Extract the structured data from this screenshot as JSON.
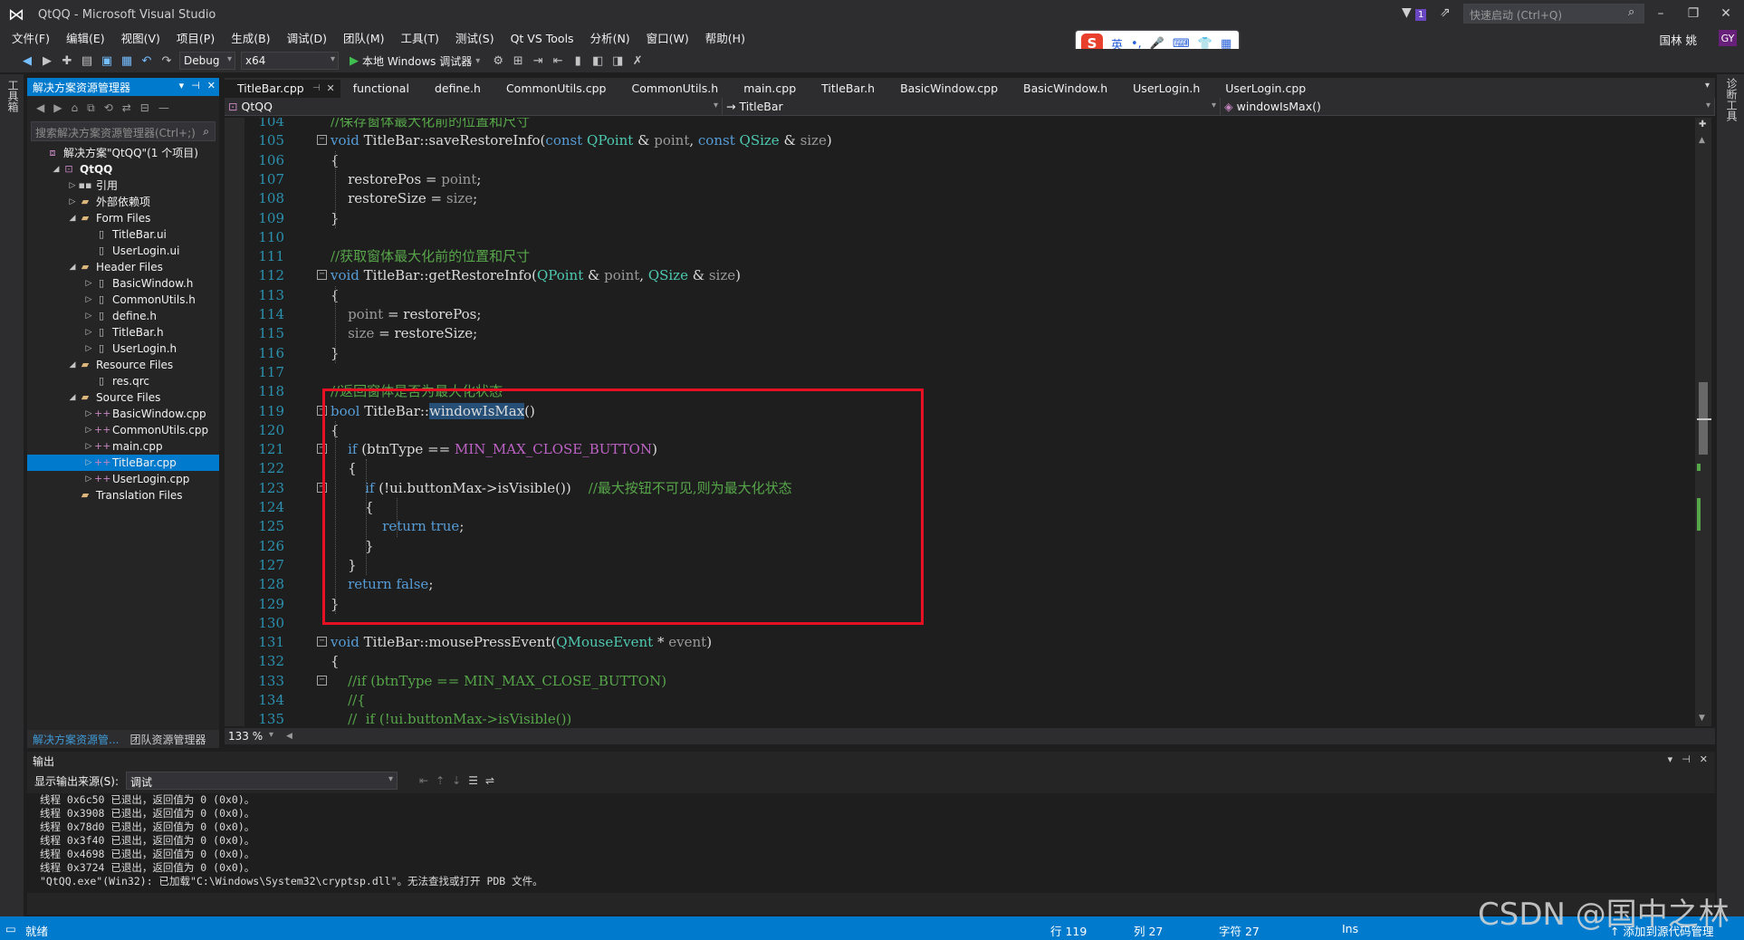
{
  "window": {
    "title": "QtQQ - Microsoft Visual Studio",
    "quick_launch_placeholder": "快速启动 (Ctrl+Q)",
    "notification_count": "1",
    "user": "国林 姚",
    "avatar_initials": "GY"
  },
  "ime": {
    "mode": "英",
    "items": [
      "•,",
      "🎤",
      "⌨",
      "👕",
      "▦"
    ]
  },
  "menu": [
    "文件(F)",
    "编辑(E)",
    "视图(V)",
    "项目(P)",
    "生成(B)",
    "调试(D)",
    "团队(M)",
    "工具(T)",
    "测试(S)",
    "Qt VS Tools",
    "分析(N)",
    "窗口(W)",
    "帮助(H)"
  ],
  "toolbar": {
    "config": "Debug",
    "platform": "x64",
    "run_label": "本地 Windows 调试器"
  },
  "left_strip_label": "工具箱",
  "right_strip_label": "诊断工具",
  "solution_explorer": {
    "title": "解决方案资源管理器",
    "search_placeholder": "搜索解决方案资源管理器(Ctrl+;)",
    "tree": [
      {
        "label": "解决方案\"QtQQ\"(1 个项目)",
        "depth": 0,
        "arrow": "",
        "icon": "sol"
      },
      {
        "label": "QtQQ",
        "depth": 1,
        "arrow": "◢",
        "icon": "proj",
        "bold": true
      },
      {
        "label": "引用",
        "depth": 2,
        "arrow": "▷",
        "icon": "ref"
      },
      {
        "label": "外部依赖项",
        "depth": 2,
        "arrow": "▷",
        "icon": "folder"
      },
      {
        "label": "Form Files",
        "depth": 2,
        "arrow": "◢",
        "icon": "folder"
      },
      {
        "label": "TitleBar.ui",
        "depth": 3,
        "arrow": "",
        "icon": "file"
      },
      {
        "label": "UserLogin.ui",
        "depth": 3,
        "arrow": "",
        "icon": "file"
      },
      {
        "label": "Header Files",
        "depth": 2,
        "arrow": "◢",
        "icon": "folder"
      },
      {
        "label": "BasicWindow.h",
        "depth": 3,
        "arrow": "▷",
        "icon": "file"
      },
      {
        "label": "CommonUtils.h",
        "depth": 3,
        "arrow": "▷",
        "icon": "file"
      },
      {
        "label": "define.h",
        "depth": 3,
        "arrow": "▷",
        "icon": "file"
      },
      {
        "label": "TitleBar.h",
        "depth": 3,
        "arrow": "▷",
        "icon": "file"
      },
      {
        "label": "UserLogin.h",
        "depth": 3,
        "arrow": "▷",
        "icon": "file"
      },
      {
        "label": "Resource Files",
        "depth": 2,
        "arrow": "◢",
        "icon": "folder"
      },
      {
        "label": "res.qrc",
        "depth": 3,
        "arrow": "",
        "icon": "file"
      },
      {
        "label": "Source Files",
        "depth": 2,
        "arrow": "◢",
        "icon": "folder"
      },
      {
        "label": "BasicWindow.cpp",
        "depth": 3,
        "arrow": "▷",
        "icon": "cpp"
      },
      {
        "label": "CommonUtils.cpp",
        "depth": 3,
        "arrow": "▷",
        "icon": "cpp"
      },
      {
        "label": "main.cpp",
        "depth": 3,
        "arrow": "▷",
        "icon": "cpp"
      },
      {
        "label": "TitleBar.cpp",
        "depth": 3,
        "arrow": "▷",
        "icon": "cpp",
        "selected": true
      },
      {
        "label": "UserLogin.cpp",
        "depth": 3,
        "arrow": "▷",
        "icon": "cpp"
      },
      {
        "label": "Translation Files",
        "depth": 2,
        "arrow": "",
        "icon": "folder"
      }
    ],
    "bottom_tabs": [
      "解决方案资源管...",
      "团队资源管理器"
    ]
  },
  "doc_tabs": [
    "TitleBar.cpp",
    "functional",
    "define.h",
    "CommonUtils.cpp",
    "CommonUtils.h",
    "main.cpp",
    "TitleBar.h",
    "BasicWindow.cpp",
    "BasicWindow.h",
    "UserLogin.h",
    "UserLogin.cpp"
  ],
  "nav": {
    "project": "QtQQ",
    "class": "TitleBar",
    "member": "windowIsMax()"
  },
  "code_lines": [
    {
      "n": "104",
      "fold": "",
      "html": [
        [
          "c-com",
          "//保存窗体最大化前的位置和尺寸"
        ]
      ]
    },
    {
      "n": "105",
      "fold": "-",
      "html": [
        [
          "c-kw",
          "void"
        ],
        [
          "",
          " TitleBar::saveRestoreInfo("
        ],
        [
          "c-kw",
          "const"
        ],
        [
          "",
          " "
        ],
        [
          "c-type",
          "QPoint"
        ],
        [
          "",
          " & "
        ],
        [
          "c-param",
          "point"
        ],
        [
          "",
          ", "
        ],
        [
          "c-kw",
          "const"
        ],
        [
          "",
          " "
        ],
        [
          "c-type",
          "QSize"
        ],
        [
          "",
          " & "
        ],
        [
          "c-param",
          "size"
        ],
        [
          "",
          ")"
        ]
      ]
    },
    {
      "n": "106",
      "fold": "",
      "html": [
        [
          "",
          "{"
        ]
      ]
    },
    {
      "n": "107",
      "fold": "",
      "html": [
        [
          "",
          "    restorePos = "
        ],
        [
          "c-param",
          "point"
        ],
        [
          "",
          ";"
        ]
      ]
    },
    {
      "n": "108",
      "fold": "",
      "html": [
        [
          "",
          "    restoreSize = "
        ],
        [
          "c-param",
          "size"
        ],
        [
          "",
          ";"
        ]
      ]
    },
    {
      "n": "109",
      "fold": "",
      "html": [
        [
          "",
          "}"
        ]
      ]
    },
    {
      "n": "110",
      "fold": "",
      "html": []
    },
    {
      "n": "111",
      "fold": "",
      "html": [
        [
          "c-com",
          "//获取窗体最大化前的位置和尺寸"
        ]
      ]
    },
    {
      "n": "112",
      "fold": "-",
      "html": [
        [
          "c-kw",
          "void"
        ],
        [
          "",
          " TitleBar::getRestoreInfo("
        ],
        [
          "c-type",
          "QPoint"
        ],
        [
          "",
          " & "
        ],
        [
          "c-param",
          "point"
        ],
        [
          "",
          ", "
        ],
        [
          "c-type",
          "QSize"
        ],
        [
          "",
          " & "
        ],
        [
          "c-param",
          "size"
        ],
        [
          "",
          ")"
        ]
      ]
    },
    {
      "n": "113",
      "fold": "",
      "html": [
        [
          "",
          "{"
        ]
      ]
    },
    {
      "n": "114",
      "fold": "",
      "html": [
        [
          "",
          "    "
        ],
        [
          "c-param",
          "point"
        ],
        [
          "",
          " = restorePos;"
        ]
      ]
    },
    {
      "n": "115",
      "fold": "",
      "html": [
        [
          "",
          "    "
        ],
        [
          "c-param",
          "size"
        ],
        [
          "",
          " = restoreSize;"
        ]
      ]
    },
    {
      "n": "116",
      "fold": "",
      "html": [
        [
          "",
          "}"
        ]
      ]
    },
    {
      "n": "117",
      "fold": "",
      "html": []
    },
    {
      "n": "118",
      "fold": "",
      "html": [
        [
          "c-com",
          "//返回窗体是否为最大化状态"
        ]
      ]
    },
    {
      "n": "119",
      "fold": "-",
      "html": [
        [
          "c-kw",
          "bool"
        ],
        [
          "",
          " TitleBar::"
        ],
        [
          "c-hl",
          "windowIsMax"
        ],
        [
          "",
          "()"
        ]
      ]
    },
    {
      "n": "120",
      "fold": "",
      "html": [
        [
          "",
          "{"
        ]
      ]
    },
    {
      "n": "121",
      "fold": "-",
      "html": [
        [
          "",
          "    "
        ],
        [
          "c-kw",
          "if"
        ],
        [
          "",
          " (btnType == "
        ],
        [
          "c-macro",
          "MIN_MAX_CLOSE_BUTTON"
        ],
        [
          "",
          ")"
        ]
      ]
    },
    {
      "n": "122",
      "fold": "",
      "html": [
        [
          "",
          "    {"
        ]
      ]
    },
    {
      "n": "123",
      "fold": "-",
      "html": [
        [
          "",
          "        "
        ],
        [
          "c-kw",
          "if"
        ],
        [
          "",
          " (!ui.buttonMax->isVisible())    "
        ],
        [
          "c-com",
          "//最大按钮不可见,则为最大化状态"
        ]
      ]
    },
    {
      "n": "124",
      "fold": "",
      "html": [
        [
          "",
          "        {"
        ]
      ]
    },
    {
      "n": "125",
      "fold": "",
      "html": [
        [
          "",
          "            "
        ],
        [
          "c-kw",
          "return"
        ],
        [
          "",
          " "
        ],
        [
          "c-kw",
          "true"
        ],
        [
          "",
          ";"
        ]
      ]
    },
    {
      "n": "126",
      "fold": "",
      "html": [
        [
          "",
          "        }"
        ]
      ]
    },
    {
      "n": "127",
      "fold": "",
      "html": [
        [
          "",
          "    }"
        ]
      ]
    },
    {
      "n": "128",
      "fold": "",
      "html": [
        [
          "",
          "    "
        ],
        [
          "c-kw",
          "return"
        ],
        [
          "",
          " "
        ],
        [
          "c-kw",
          "false"
        ],
        [
          "",
          ";"
        ]
      ]
    },
    {
      "n": "129",
      "fold": "",
      "html": [
        [
          "",
          "}"
        ]
      ]
    },
    {
      "n": "130",
      "fold": "",
      "html": []
    },
    {
      "n": "131",
      "fold": "-",
      "html": [
        [
          "c-kw",
          "void"
        ],
        [
          "",
          " TitleBar::mousePressEvent("
        ],
        [
          "c-type",
          "QMouseEvent"
        ],
        [
          "",
          " * "
        ],
        [
          "c-param",
          "event"
        ],
        [
          "",
          ")"
        ]
      ]
    },
    {
      "n": "132",
      "fold": "",
      "html": [
        [
          "",
          "{"
        ]
      ]
    },
    {
      "n": "133",
      "fold": "-",
      "html": [
        [
          "",
          "    "
        ],
        [
          "c-com",
          "//if (btnType == MIN_MAX_CLOSE_BUTTON)"
        ]
      ]
    },
    {
      "n": "134",
      "fold": "",
      "html": [
        [
          "",
          "    "
        ],
        [
          "c-com",
          "//{"
        ]
      ]
    },
    {
      "n": "135",
      "fold": "",
      "html": [
        [
          "",
          "    "
        ],
        [
          "c-com",
          "//  if (!ui.buttonMax->isVisible())"
        ]
      ]
    }
  ],
  "zoom": "133 %",
  "output": {
    "title": "输出",
    "source_label": "显示输出来源(S):",
    "source_value": "调试",
    "lines": [
      "线程 0x6c50 已退出，返回值为 0 (0x0)。",
      "线程 0x3908 已退出，返回值为 0 (0x0)。",
      "线程 0x78d0 已退出，返回值为 0 (0x0)。",
      "线程 0x3f40 已退出，返回值为 0 (0x0)。",
      "线程 0x4698 已退出，返回值为 0 (0x0)。",
      "线程 0x3724 已退出，返回值为 0 (0x0)。",
      "\"QtQQ.exe\"(Win32): 已加载\"C:\\Windows\\System32\\cryptsp.dll\"。无法查找或打开 PDB 文件。"
    ]
  },
  "status": {
    "ready": "就绪",
    "line": "行 119",
    "col": "列 27",
    "char": "字符 27",
    "ins": "Ins",
    "source_control": "添加到源代码管理"
  },
  "watermark": "CSDN @国中之林"
}
